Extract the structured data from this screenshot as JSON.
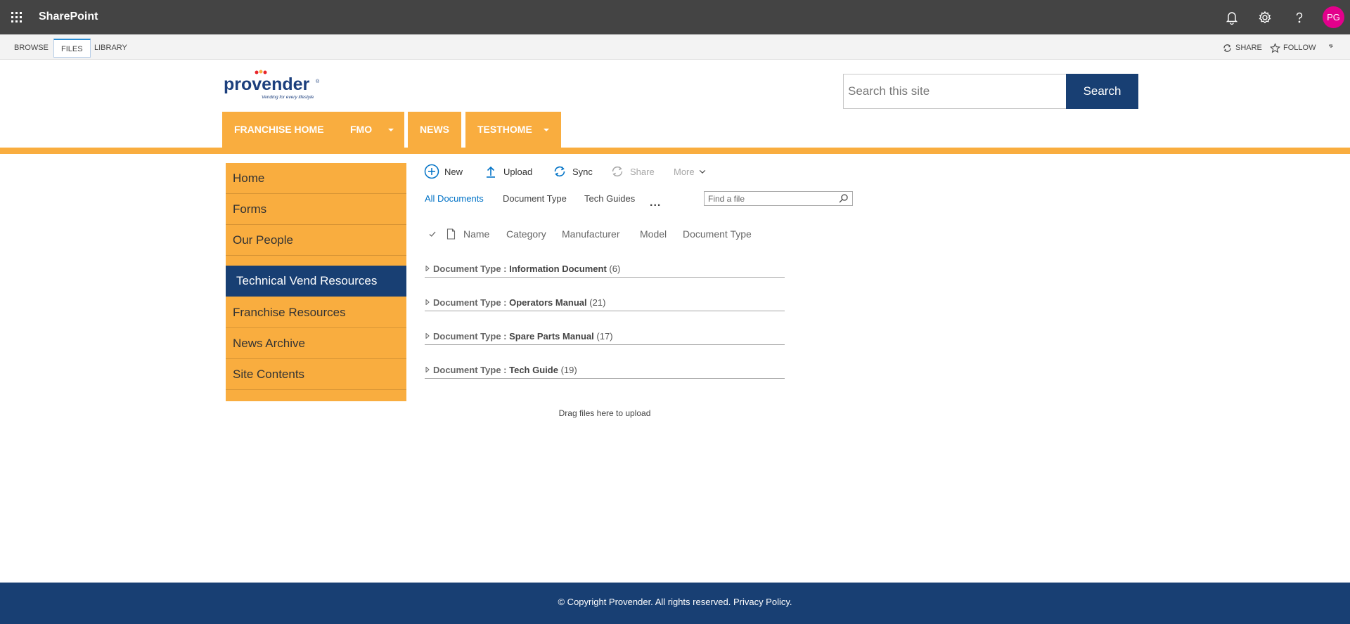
{
  "suite_bar": {
    "app_title": "SharePoint",
    "avatar_initials": "PG",
    "avatar_color": "#e3008c",
    "icons": [
      "app-launcher-icon",
      "bell-icon",
      "gear-icon",
      "help-icon"
    ]
  },
  "ribbon": {
    "tabs": [
      "BROWSE",
      "FILES",
      "LIBRARY"
    ],
    "active_tab": "FILES",
    "share_label": "SHARE",
    "follow_label": "FOLLOW"
  },
  "logo": {
    "name": "provender",
    "tagline": "Vending for every lifestyle"
  },
  "search": {
    "placeholder": "Search this site",
    "button_label": "Search"
  },
  "top_nav": [
    {
      "label": "FRANCHISE HOME",
      "has_dropdown": false
    },
    {
      "label": "FMO",
      "has_dropdown": true
    },
    {
      "label": "NEWS",
      "has_dropdown": false
    },
    {
      "label": "TESTHOME",
      "has_dropdown": true
    }
  ],
  "quick_launch": {
    "items": [
      "Home",
      "Forms",
      "Our People",
      "Technical Vend Resources",
      "Franchise Resources",
      "News Archive",
      "Site Contents"
    ],
    "selected": "Technical Vend Resources"
  },
  "command_bar": {
    "new_label": "New",
    "upload_label": "Upload",
    "sync_label": "Sync",
    "share_label": "Share",
    "more_label": "More"
  },
  "views": {
    "tabs": [
      "All Documents",
      "Document Type",
      "Tech Guides"
    ],
    "active": "All Documents",
    "more_label": "...",
    "find_placeholder": "Find a file"
  },
  "columns": [
    "Name",
    "Category",
    "Manufacturer",
    "Model",
    "Document Type"
  ],
  "groups": [
    {
      "field": "Document Type",
      "value": "Information Document",
      "count": "(6)"
    },
    {
      "field": "Document Type",
      "value": "Operators Manual",
      "count": "(21)"
    },
    {
      "field": "Document Type",
      "value": "Spare Parts Manual",
      "count": "(17)"
    },
    {
      "field": "Document Type",
      "value": "Tech Guide",
      "count": "(19)"
    }
  ],
  "drag_hint": "Drag files here to upload",
  "footer": {
    "copyright": "© Copyright Provender. All rights reserved. Privacy Policy."
  },
  "colors": {
    "suite_bar": "#444444",
    "accent_orange": "#f9ad3f",
    "brand_navy": "#183f73",
    "link_blue": "#0072c6"
  }
}
